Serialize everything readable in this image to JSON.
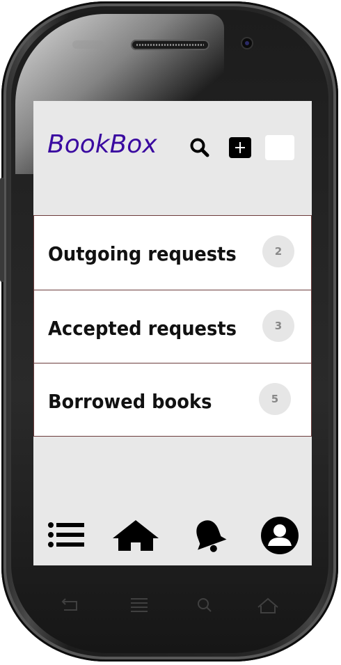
{
  "app": {
    "title": "BookBox"
  },
  "toolbar": {
    "search_icon": "search-icon",
    "add_icon": "plus-square-icon",
    "menu_icon": "blank-menu-button"
  },
  "list": {
    "items": [
      {
        "label": "Outgoing requests",
        "count": "2"
      },
      {
        "label": "Accepted requests",
        "count": "3"
      },
      {
        "label": "Borrowed books",
        "count": "5"
      }
    ]
  },
  "bottom_nav": {
    "items": [
      "list-icon",
      "home-icon",
      "bell-icon",
      "profile-icon"
    ]
  },
  "colors": {
    "title": "#3a0aa0",
    "screen_bg": "#e8e8e8",
    "item_border": "#6b3b3b",
    "badge_bg": "#e6e6e6"
  }
}
